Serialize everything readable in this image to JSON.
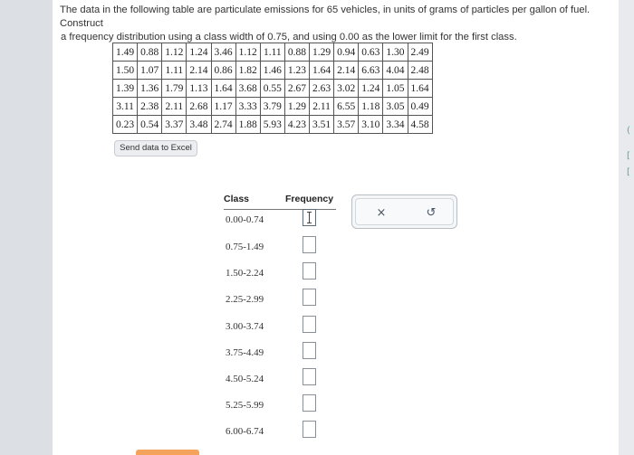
{
  "prompt": {
    "line1": "The data in the following table are particulate emissions for 65 vehicles, in units of grams of particles per gallon of fuel. Construct",
    "line2": "a frequency distribution using a class width of 0.75, and using 0.00 as the lower limit for the first class."
  },
  "data_table": {
    "rows": [
      [
        "1.49",
        "0.88",
        "1.12",
        "1.24",
        "3.46",
        "1.12",
        "1.11",
        "0.88",
        "1.29",
        "0.94",
        "0.63",
        "1.30",
        "2.49"
      ],
      [
        "1.50",
        "1.07",
        "1.11",
        "2.14",
        "0.86",
        "1.82",
        "1.46",
        "1.23",
        "1.64",
        "2.14",
        "6.63",
        "4.04",
        "2.48"
      ],
      [
        "1.39",
        "1.36",
        "1.79",
        "1.13",
        "1.64",
        "3.68",
        "0.55",
        "2.67",
        "2.63",
        "3.02",
        "1.24",
        "1.05",
        "1.64"
      ],
      [
        "3.11",
        "2.38",
        "2.11",
        "2.68",
        "1.17",
        "3.33",
        "3.79",
        "1.29",
        "2.11",
        "6.55",
        "1.18",
        "3.05",
        "0.49"
      ],
      [
        "0.23",
        "0.54",
        "3.37",
        "3.48",
        "2.74",
        "1.88",
        "5.93",
        "4.23",
        "3.51",
        "3.57",
        "3.10",
        "3.34",
        "4.58"
      ]
    ]
  },
  "excel_button": {
    "label": "Send data to Excel"
  },
  "frequency_table": {
    "header_class": "Class",
    "header_frequency": "Frequency",
    "classes": [
      "0.00-0.74",
      "0.75-1.49",
      "1.50-2.24",
      "2.25-2.99",
      "3.00-3.74",
      "3.75-4.49",
      "4.50-5.24",
      "5.25-5.99",
      "6.00-6.74"
    ],
    "frequencies": [
      "",
      "",
      "",
      "",
      "",
      "",
      "",
      "",
      ""
    ]
  },
  "tools": {
    "clear_icon": "x-icon",
    "clear_symbol": "×",
    "reset_icon": "undo-icon",
    "reset_symbol": "↺"
  },
  "colors": {
    "background": "#dcdfe3",
    "accent": "#f4a35c"
  }
}
